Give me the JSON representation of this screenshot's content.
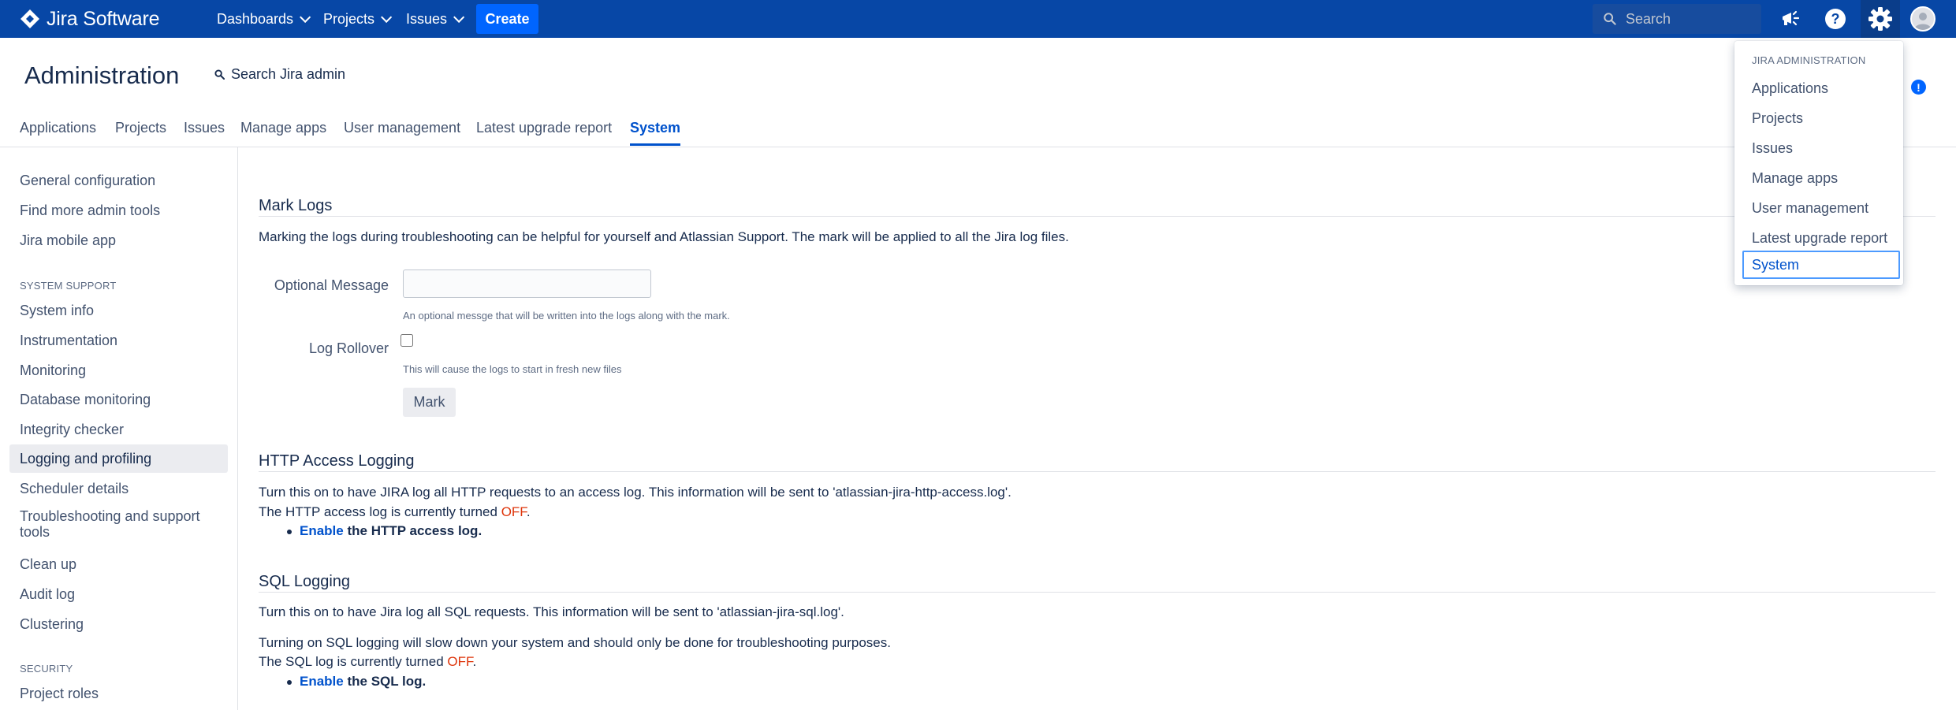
{
  "topnav": {
    "product_name": "Jira Software",
    "menus": [
      {
        "label": "Dashboards"
      },
      {
        "label": "Projects"
      },
      {
        "label": "Issues"
      }
    ],
    "create_label": "Create",
    "search_placeholder": "Search",
    "icons": [
      "jira-logo-icon",
      "megaphone-icon",
      "help-icon",
      "gear-icon",
      "avatar"
    ]
  },
  "header": {
    "title": "Administration",
    "search_label": "Search Jira admin"
  },
  "admin_tabs": [
    {
      "label": "Applications"
    },
    {
      "label": "Projects"
    },
    {
      "label": "Issues"
    },
    {
      "label": "Manage apps"
    },
    {
      "label": "User management"
    },
    {
      "label": "Latest upgrade report"
    },
    {
      "label": "System",
      "active": true
    }
  ],
  "sidebar": {
    "top_items": [
      "General configuration",
      "Find more admin tools",
      "Jira mobile app"
    ],
    "system_support_heading": "SYSTEM SUPPORT",
    "system_support_items": [
      "System info",
      "Instrumentation",
      "Monitoring",
      "Database monitoring",
      "Integrity checker",
      "Logging and profiling",
      "Scheduler details",
      "Troubleshooting and support tools",
      "Clean up",
      "Audit log",
      "Clustering"
    ],
    "selected_item": "Logging and profiling",
    "security_heading": "SECURITY",
    "security_items": [
      "Project roles"
    ]
  },
  "mark_logs": {
    "title": "Mark Logs",
    "description": "Marking the logs during troubleshooting can be helpful for yourself and Atlassian Support. The mark will be applied to all the Jira log files.",
    "optional_message_label": "Optional Message",
    "optional_message_value": "",
    "optional_message_help": "An optional messge that will be written into the logs along with the mark.",
    "log_rollover_label": "Log Rollover",
    "log_rollover_help": "This will cause the logs to start in fresh new files",
    "mark_button": "Mark"
  },
  "http_logging": {
    "title": "HTTP Access Logging",
    "line1": "Turn this on to have JIRA log all HTTP requests to an access log. This information will be sent to 'atlassian-jira-http-access.log'.",
    "status_prefix": "The HTTP access log is currently turned ",
    "status_value": "OFF",
    "status_suffix": ".",
    "enable_link": "Enable",
    "enable_rest": " the HTTP access log."
  },
  "sql_logging": {
    "title": "SQL Logging",
    "line1": "Turn this on to have Jira log all SQL requests. This information will be sent to 'atlassian-jira-sql.log'.",
    "line2": "Turning on SQL logging will slow down your system and should only be done for troubleshooting purposes.",
    "status_prefix": "The SQL log is currently turned ",
    "status_value": "OFF",
    "status_suffix": ".",
    "enable_link": "Enable",
    "enable_rest": " the SQL log."
  },
  "admin_dropdown": {
    "heading": "JIRA ADMINISTRATION",
    "items": [
      "Applications",
      "Projects",
      "Issues",
      "Manage apps",
      "User management",
      "Latest upgrade report",
      "System"
    ],
    "focused_item": "System"
  },
  "colors": {
    "nav_bg": "#0747a6",
    "create_button": "#0065ff",
    "link": "#0052cc",
    "off_status": "#de350b"
  }
}
